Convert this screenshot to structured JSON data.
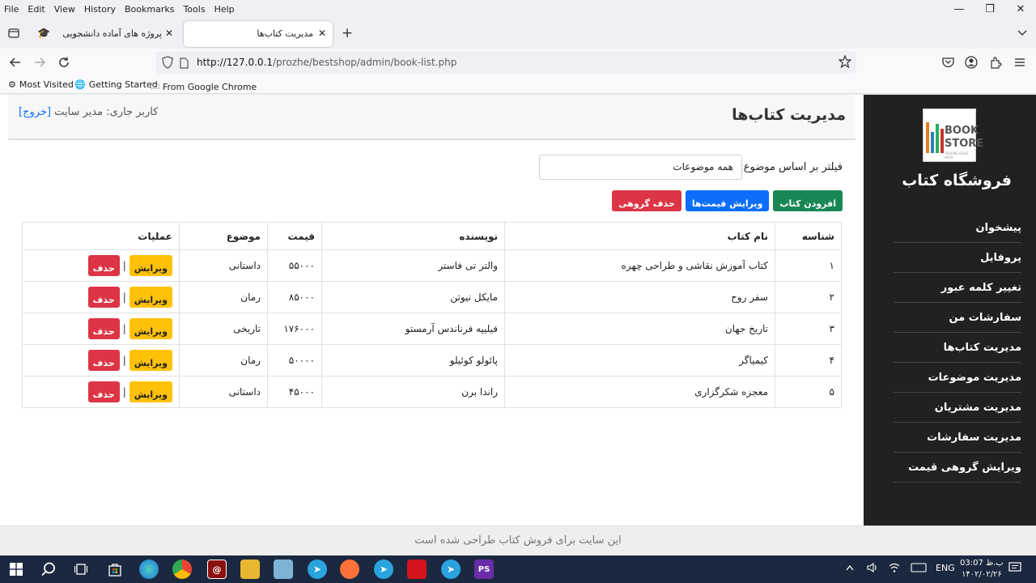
{
  "browser": {
    "menu": [
      "File",
      "Edit",
      "View",
      "History",
      "Bookmarks",
      "Tools",
      "Help"
    ],
    "tabs": [
      {
        "title": "پروژه های آماده دانشجویی",
        "close": "✕"
      },
      {
        "title": "مدیریت کتاب‌ها",
        "close": "✕"
      }
    ],
    "new_tab": "+",
    "url_host": "http://127.0.0.1",
    "url_path": "/prozhe/bestshop/admin/book-list.php",
    "bookmarks": [
      "Most Visited",
      "Getting Started",
      "From Google Chrome"
    ],
    "win_controls": [
      "—",
      "❐",
      "✕"
    ]
  },
  "sidebar": {
    "logo_line1": "BOOK",
    "logo_line2": "STORE",
    "logo_slogan": "TAGLINE GOES HERE",
    "title": "فروشگاه کتاب",
    "items": [
      "پیشخوان",
      "پروفایل",
      "تغییر کلمه عبور",
      "سفارشات من",
      "مدیریت کتاب‌ها",
      "مدیریت موضوعات",
      "مدیریت مشتریان",
      "مدیریت سفارشات",
      "ویرایش گروهی قیمت"
    ]
  },
  "header": {
    "title": "مدیریت کتاب‌ها",
    "user_label": "کاربر جاری: مدیر سایت",
    "logout": "[خروج]"
  },
  "filter": {
    "label": "فیلتر بر اساس موضوع:",
    "selected": "همه موضوعات"
  },
  "actions": {
    "add": "افزودن کتاب",
    "edit_prices": "ویرایش قیمت‌ها",
    "bulk_delete": "حذف گروهی"
  },
  "table": {
    "headers": [
      "شناسه",
      "نام کتاب",
      "نویسنده",
      "قیمت",
      "موضوع",
      "عملیات"
    ],
    "edit_label": "ویرایش",
    "delete_label": "حذف",
    "separator": "|",
    "rows": [
      {
        "id": "۱",
        "name": "کتاب آموزش نقاشی و طراحی چهره",
        "author": "والتر تی فاستر",
        "price": "۵۵۰۰۰",
        "topic": "داستانی"
      },
      {
        "id": "۲",
        "name": "سفر روح",
        "author": "مایکل نیوتن",
        "price": "۸۵۰۰۰",
        "topic": "رمان"
      },
      {
        "id": "۳",
        "name": "تاریخ جهان",
        "author": "فیلیپه فرناندس آرمستو",
        "price": "۱۷۶۰۰۰",
        "topic": "تاریخی"
      },
      {
        "id": "۴",
        "name": "کیمیاگر",
        "author": "پائولو کوئیلو",
        "price": "۵۰۰۰۰",
        "topic": "رمان"
      },
      {
        "id": "۵",
        "name": "معجزه شکرگزاری",
        "author": "راندا برن",
        "price": "۴۵۰۰۰",
        "topic": "داستانی"
      }
    ]
  },
  "footer": "این سایت برای فروش کتاب طراحی شده است",
  "taskbar": {
    "lang": "ENG",
    "time": "03:07 ب.ظ",
    "date": "۱۴۰۲/۰۲/۲۶"
  },
  "colors": {
    "sidebar_bg": "#212121",
    "green": "#198754",
    "blue": "#0d6efd",
    "red": "#dc3545",
    "yellow": "#ffc107",
    "taskbar_bg": "#1b2940"
  }
}
